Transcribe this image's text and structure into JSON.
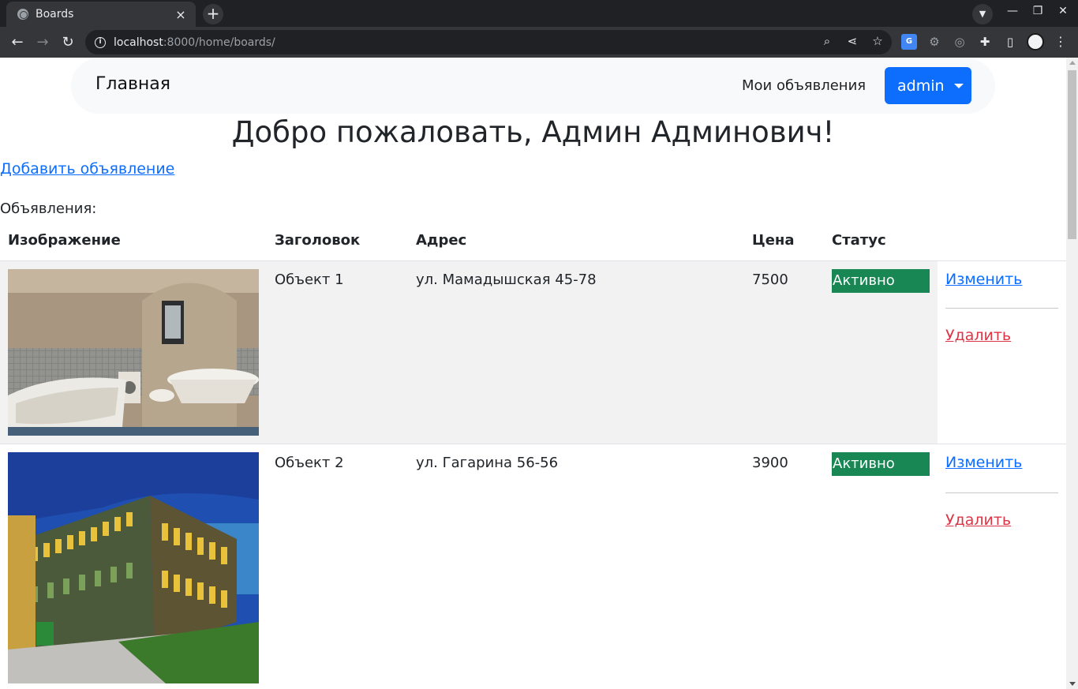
{
  "browser": {
    "tab_title": "Boards",
    "url_host": "localhost",
    "url_rest": ":8000/home/boards/"
  },
  "navbar": {
    "brand": "Главная",
    "my_ads": "Мои объявления",
    "user_button": "admin"
  },
  "page": {
    "welcome": "Добро пожаловать, Админ Админович!",
    "add_link": "Добавить объявление",
    "ads_label": "Объявления:"
  },
  "table": {
    "headers": [
      "Изображение",
      "Заголовок",
      "Адрес",
      "Цена",
      "Статус"
    ],
    "rows": [
      {
        "image": "bathroom-photo",
        "title": "Объект 1",
        "address": "ул. Мамадышская 45-78",
        "price": "7500",
        "status": "Активно",
        "edit": "Изменить",
        "delete": "Удалить"
      },
      {
        "image": "building-photo",
        "title": "Объект 2",
        "address": "ул. Гагарина 56-56",
        "price": "3900",
        "status": "Активно",
        "edit": "Изменить",
        "delete": "Удалить"
      }
    ]
  },
  "colors": {
    "primary": "#0d6efd",
    "success": "#198754",
    "danger": "#dc3545",
    "chrome_dark": "#202124",
    "chrome_toolbar": "#35363a"
  }
}
